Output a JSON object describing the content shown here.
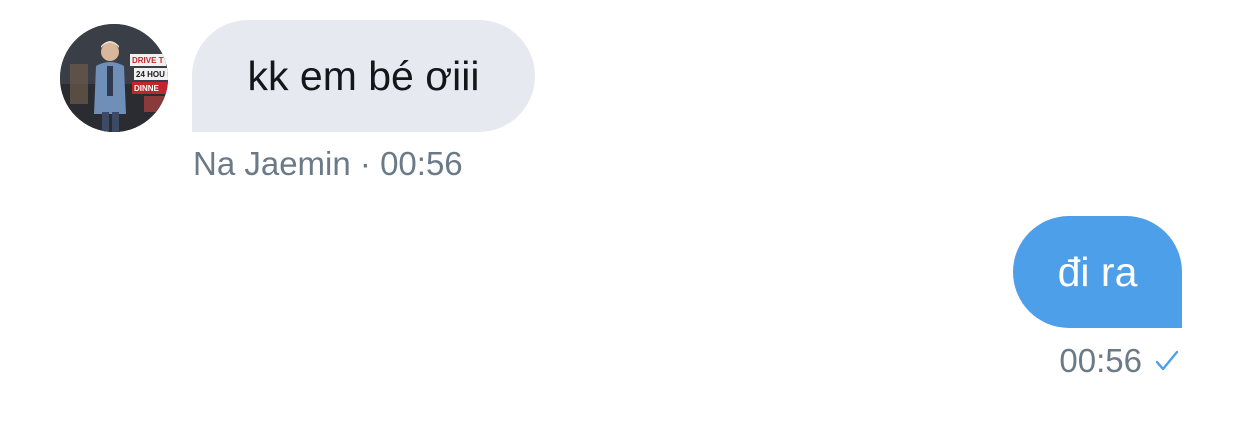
{
  "incoming": {
    "message": "kk em bé ơiii",
    "sender": "Na Jaemin",
    "separator": "·",
    "time": "00:56"
  },
  "outgoing": {
    "message": "đi ra",
    "time": "00:56",
    "status_icon": "checkmark-icon"
  },
  "avatar": {
    "sign_text_1": "DRIVE T",
    "sign_text_2": "24 HOU",
    "sign_text_3": "DINNE"
  },
  "colors": {
    "incoming_bubble": "#e6e9ef",
    "outgoing_bubble": "#4d9fe9",
    "meta_text": "#6b7a87",
    "check": "#4d9fe9"
  }
}
